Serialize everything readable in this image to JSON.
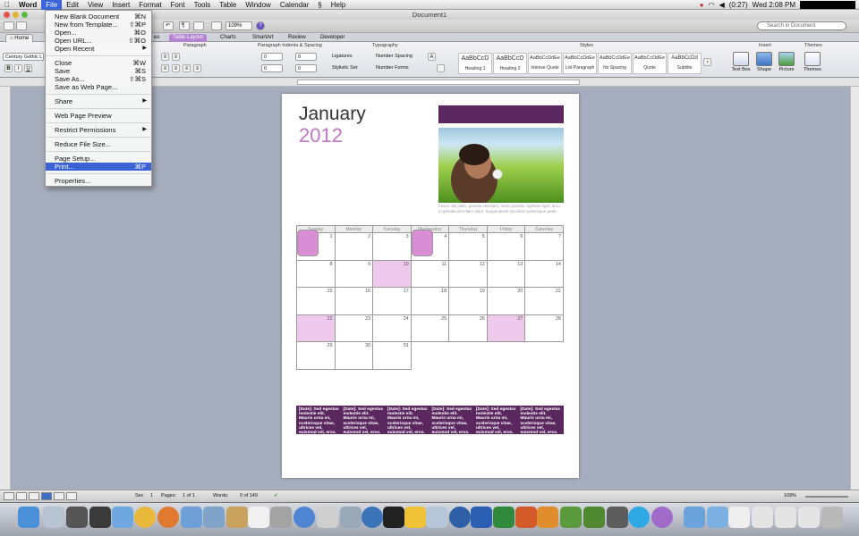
{
  "menubar": {
    "items": [
      "Word",
      "File",
      "Edit",
      "View",
      "Insert",
      "Format",
      "Font",
      "Tools",
      "Table",
      "Window",
      "Calendar",
      "Help"
    ],
    "active": "File",
    "battery": "(0:27)",
    "clock": "Wed 2:08 PM"
  },
  "window": {
    "title": "Document1"
  },
  "toolbar": {
    "zoom": "109%",
    "search_placeholder": "Search in Document"
  },
  "ribbon_tabs": {
    "home": "Home",
    "layout_partial": "es",
    "table_layout": "Table Layout",
    "charts": "Charts",
    "smartart": "SmartArt",
    "review": "Review",
    "developer": "Developer"
  },
  "ribbon": {
    "font_name": "Century Gothic L",
    "group_paragraph": "Paragraph",
    "group_indents": "Paragraph Indents & Spacing",
    "group_typography": "Typography",
    "group_styles": "Styles",
    "group_insert": "Insert",
    "group_themes": "Themes",
    "indent_vals": [
      "0",
      "0",
      "0",
      "0"
    ],
    "ligatures": "Ligatures",
    "stylistic_set": "Stylistic Set",
    "number_spacing": "Number Spacing",
    "number_forms": "Number Forms",
    "styles": [
      {
        "preview": "AaBbCcD",
        "name": "Heading 1"
      },
      {
        "preview": "AaBbCcD",
        "name": "Heading 2"
      },
      {
        "preview": "AaBbCcDdEe",
        "name": "Intense Quote"
      },
      {
        "preview": "AaBbCcDdEe",
        "name": "List Paragraph"
      },
      {
        "preview": "AaBbCcDdEe",
        "name": "No Spacing"
      },
      {
        "preview": "AaBbCcDdEe",
        "name": "Quote"
      },
      {
        "preview": "AaBbCcDd",
        "name": "Subtitle"
      }
    ],
    "insert_buttons": [
      "Text Box",
      "Shape",
      "Picture"
    ],
    "themes_button": "Themes"
  },
  "file_menu": {
    "items": [
      {
        "label": "New Blank Document",
        "shortcut": "⌘N"
      },
      {
        "label": "New from Template...",
        "shortcut": "⇧⌘P"
      },
      {
        "label": "Open...",
        "shortcut": "⌘O"
      },
      {
        "label": "Open URL...",
        "shortcut": "⇧⌘O"
      },
      {
        "label": "Open Recent",
        "shortcut": ""
      },
      {
        "label": "Close",
        "shortcut": "⌘W"
      },
      {
        "label": "Save",
        "shortcut": "⌘S"
      },
      {
        "label": "Save As...",
        "shortcut": "⇧⌘S"
      },
      {
        "label": "Save as Web Page...",
        "shortcut": ""
      },
      {
        "label": "Share",
        "shortcut": ""
      },
      {
        "label": "Web Page Preview",
        "shortcut": ""
      },
      {
        "label": "Restrict Permissions",
        "shortcut": ""
      },
      {
        "label": "Reduce File Size...",
        "shortcut": ""
      },
      {
        "label": "Page Setup...",
        "shortcut": ""
      },
      {
        "label": "Print...",
        "shortcut": "⌘P"
      },
      {
        "label": "Properties...",
        "shortcut": ""
      }
    ],
    "highlighted": "Print..."
  },
  "document": {
    "month": "January",
    "year": "2012",
    "caption": "Fusce nisl justo, gravida interdum, tortor gravida, egestas eget, arcu. In gravida dict diam dolor. Suspendisse tincidunt scelerisque pede.",
    "weekdays": [
      "Sunday",
      "Monday",
      "Tuesday",
      "Wednesday",
      "Thursday",
      "Friday",
      "Saturday"
    ],
    "weeks": [
      [
        "",
        "1",
        "2",
        "3",
        "4",
        "5",
        "6",
        "7"
      ],
      [
        "8",
        "9",
        "10",
        "11",
        "12",
        "13",
        "14"
      ],
      [
        "15",
        "16",
        "17",
        "18",
        "19",
        "20",
        "21"
      ],
      [
        "22",
        "23",
        "24",
        "25",
        "26",
        "27",
        "28"
      ],
      [
        "29",
        "30",
        "31",
        "",
        "",
        "",
        ""
      ],
      [
        "",
        "",
        "",
        "",
        "",
        "",
        ""
      ]
    ],
    "event_text": "[Date]: Sed egestas molestie elit. Mauris urna mi, scelerisque vitae, ultrices vel, euismod vel, eros."
  },
  "statusbar": {
    "sec_label": "Sec",
    "sec_value": "1",
    "pages_label": "Pages:",
    "pages_value": "1 of 1",
    "words_label": "Words:",
    "words_value": "0 of 149",
    "zoom": "109%"
  },
  "colors": {
    "accent_purple": "#5b2761",
    "highlight_pink": "#efc9ec",
    "highlight_magenta": "#d98dd4",
    "year_pink": "#c474c8",
    "menu_selection": "#3c63d6"
  }
}
